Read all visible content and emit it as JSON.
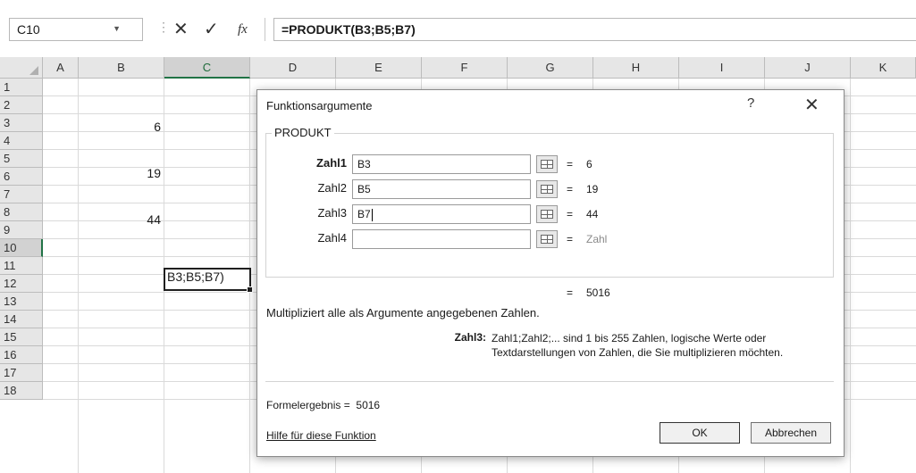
{
  "formula_bar": {
    "name_box": "C10",
    "dots": "⋮",
    "cancel_glyph": "✕",
    "enter_glyph": "✓",
    "fx_glyph": "fx",
    "formula": "=PRODUKT(B3;B5;B7)"
  },
  "columns": [
    "A",
    "B",
    "C",
    "D",
    "E",
    "F",
    "G",
    "H",
    "I",
    "J",
    "K"
  ],
  "rows": [
    "1",
    "2",
    "3",
    "4",
    "5",
    "6",
    "7",
    "8",
    "9",
    "10",
    "11",
    "12",
    "13",
    "14",
    "15",
    "16",
    "17",
    "18"
  ],
  "cells": {
    "B3": "6",
    "B5": "19",
    "B7": "44",
    "C10": "B3;B5;B7)"
  },
  "dialog": {
    "title": "Funktionsargumente",
    "help_glyph": "?",
    "close_glyph": "✕",
    "function_name": "PRODUKT",
    "args": [
      {
        "label": "Zahl1",
        "value": "B3",
        "result": "6"
      },
      {
        "label": "Zahl2",
        "value": "B5",
        "result": "19"
      },
      {
        "label": "Zahl3",
        "value": "B7",
        "result": "44"
      },
      {
        "label": "Zahl4",
        "value": "",
        "result": "Zahl"
      }
    ],
    "equals": "=",
    "result": "5016",
    "description": "Multipliziert alle als Argumente angegebenen Zahlen.",
    "arg_desc_label": "Zahl3:",
    "arg_desc_text": "Zahl1;Zahl2;... sind 1 bis 255 Zahlen, logische Werte oder Textdarstellungen von Zahlen, die Sie multiplizieren möchten.",
    "formula_result_label": "Formelergebnis =",
    "formula_result_value": "5016",
    "help_link": "Hilfe für diese Funktion",
    "ok_label": "OK",
    "cancel_label": "Abbrechen"
  }
}
